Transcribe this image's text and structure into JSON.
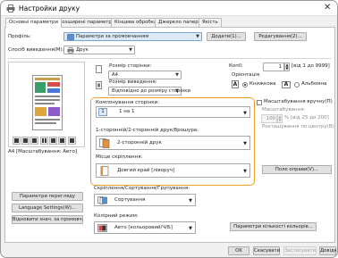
{
  "window": {
    "title": "Настройки друку",
    "close": "✕"
  },
  "tabs": [
    {
      "label": "Основні параметри",
      "active": true
    },
    {
      "label": "Розширені параметри",
      "active": false
    },
    {
      "label": "Кінцева обробка",
      "active": false
    },
    {
      "label": "Джерело паперу",
      "active": false
    },
    {
      "label": "Якість",
      "active": false
    }
  ],
  "profile": {
    "label": "Профіль:",
    "value": "Параметри за промовчанням",
    "add": "Додати(1)...",
    "edit": "Редагування(2)..."
  },
  "output": {
    "label": "Спосіб виведення(M):",
    "value": "Друк"
  },
  "preview": {
    "caption": "A4 [Масштабування: Авто]"
  },
  "left_buttons": {
    "view": "Параметри перегляду",
    "language": "Language Settings(W)...",
    "restore": "Відновити знач. за промовч."
  },
  "page_size": {
    "label": "Розмір сторінки:",
    "value": "A4"
  },
  "output_size": {
    "label": "Розмір виведення:",
    "value": "Відповідно до розміру сторінки"
  },
  "copies": {
    "label": "Копії:",
    "value": "1",
    "hint": "[від 1 до 9999]"
  },
  "orientation": {
    "label": "Орієнтація",
    "portrait": "Книжкова",
    "landscape": "Альбомна"
  },
  "layout": {
    "label": "Компонування сторінки:",
    "value": "1 на 1"
  },
  "duplex": {
    "label": "1-сторонній/2-сторонній друк/брошура:",
    "value": "2-сторонній друк"
  },
  "binding": {
    "label": "Місце скріплення:",
    "value": "Довгий край [ліворуч]"
  },
  "scaling": {
    "label": "Масштабування вручну(П)",
    "sub": "Масштабування:",
    "value": "100",
    "hint": "% [від 25 до 200]",
    "gutter": "Розташування по центру(В)"
  },
  "margin_btn": "Поле оправи(V)...",
  "stapling": {
    "label": "Скріплення/Сортування/Групування:",
    "value": "Сортування"
  },
  "color": {
    "label": "Колірний режим:",
    "value": "Авто [кольоровий/Ч/Б]"
  },
  "color_btn": "Параметри кількості кольорів...",
  "footer": {
    "ok": "OK",
    "cancel": "Скасувати",
    "apply": "Застосувати",
    "help": "Довідка"
  }
}
